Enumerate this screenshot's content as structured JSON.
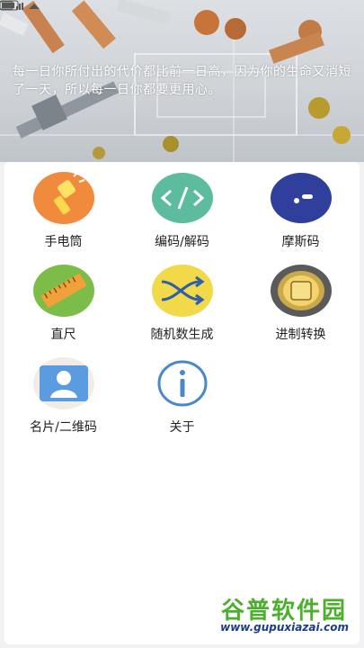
{
  "status_bar": {
    "carrier_icons": "signal-wifi-icons",
    "right_text": "",
    "battery": "battery-icon"
  },
  "banner": {
    "quote": "每一日你所付出的代价都比前一日高，因为你的生命又消短了一天，所以每一日你都要更用心。"
  },
  "tools": [
    {
      "label": "手电筒",
      "icon": "flashlight-icon",
      "color": "#f08a3c"
    },
    {
      "label": "编码/解码",
      "icon": "code-icon",
      "color": "#5dbb9e"
    },
    {
      "label": "摩斯码",
      "icon": "morse-icon",
      "color": "#2f3f9b"
    },
    {
      "label": "直尺",
      "icon": "ruler-icon",
      "color": "#7cbd4a"
    },
    {
      "label": "随机数生成",
      "icon": "shuffle-icon",
      "color": "#f2d94a"
    },
    {
      "label": "进制转换",
      "icon": "number-base-icon",
      "color": "#5a5a5a"
    },
    {
      "label": "名片/二维码",
      "icon": "business-card-icon",
      "color": "#4e8fd1"
    },
    {
      "label": "关于",
      "icon": "info-icon",
      "color": "#4a88c7"
    }
  ],
  "watermark": {
    "title": "谷普软件园",
    "url": "www.gupuxiazai.com"
  }
}
